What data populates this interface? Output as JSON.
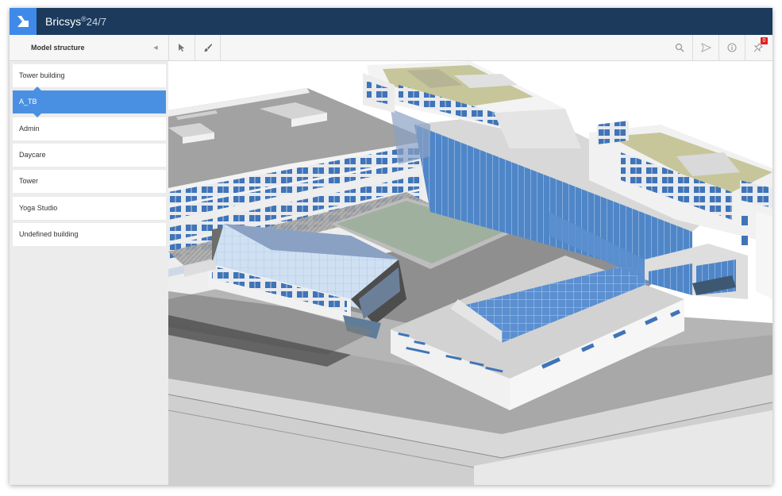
{
  "app": {
    "brand": "Bricsys",
    "brand_sup": "®",
    "brand_version": "24/7"
  },
  "panel": {
    "title": "Model structure",
    "collapse_icon": "chevron-left-icon"
  },
  "toolbar": {
    "left_tools": [
      {
        "name": "select-tool",
        "icon": "cursor-arrow-icon"
      },
      {
        "name": "paint-tool",
        "icon": "paint-brush-icon"
      }
    ],
    "right_tools": [
      {
        "name": "search-tool",
        "icon": "magnifier-icon"
      },
      {
        "name": "send-tool",
        "icon": "send-arrow-icon"
      },
      {
        "name": "info-tool",
        "icon": "info-circle-icon"
      },
      {
        "name": "pin-tool",
        "icon": "pushpin-icon"
      }
    ],
    "pin_badge": "0"
  },
  "sidebar": {
    "items": [
      {
        "label": "Tower building",
        "selected": false
      },
      {
        "label": "A_TB",
        "selected": true
      },
      {
        "label": "Admin",
        "selected": false
      },
      {
        "label": "Daycare",
        "selected": false
      },
      {
        "label": "Tower",
        "selected": false
      },
      {
        "label": "Yoga Studio",
        "selected": false
      },
      {
        "label": "Undefined building",
        "selected": false
      }
    ]
  },
  "colors": {
    "titlebar": "#1b3a5c",
    "logo_bg": "#3f8ae8",
    "selected": "#4a90e2",
    "badge": "#e02020",
    "glass": "#5b8fd0",
    "roof_green": "#c7c69a"
  }
}
